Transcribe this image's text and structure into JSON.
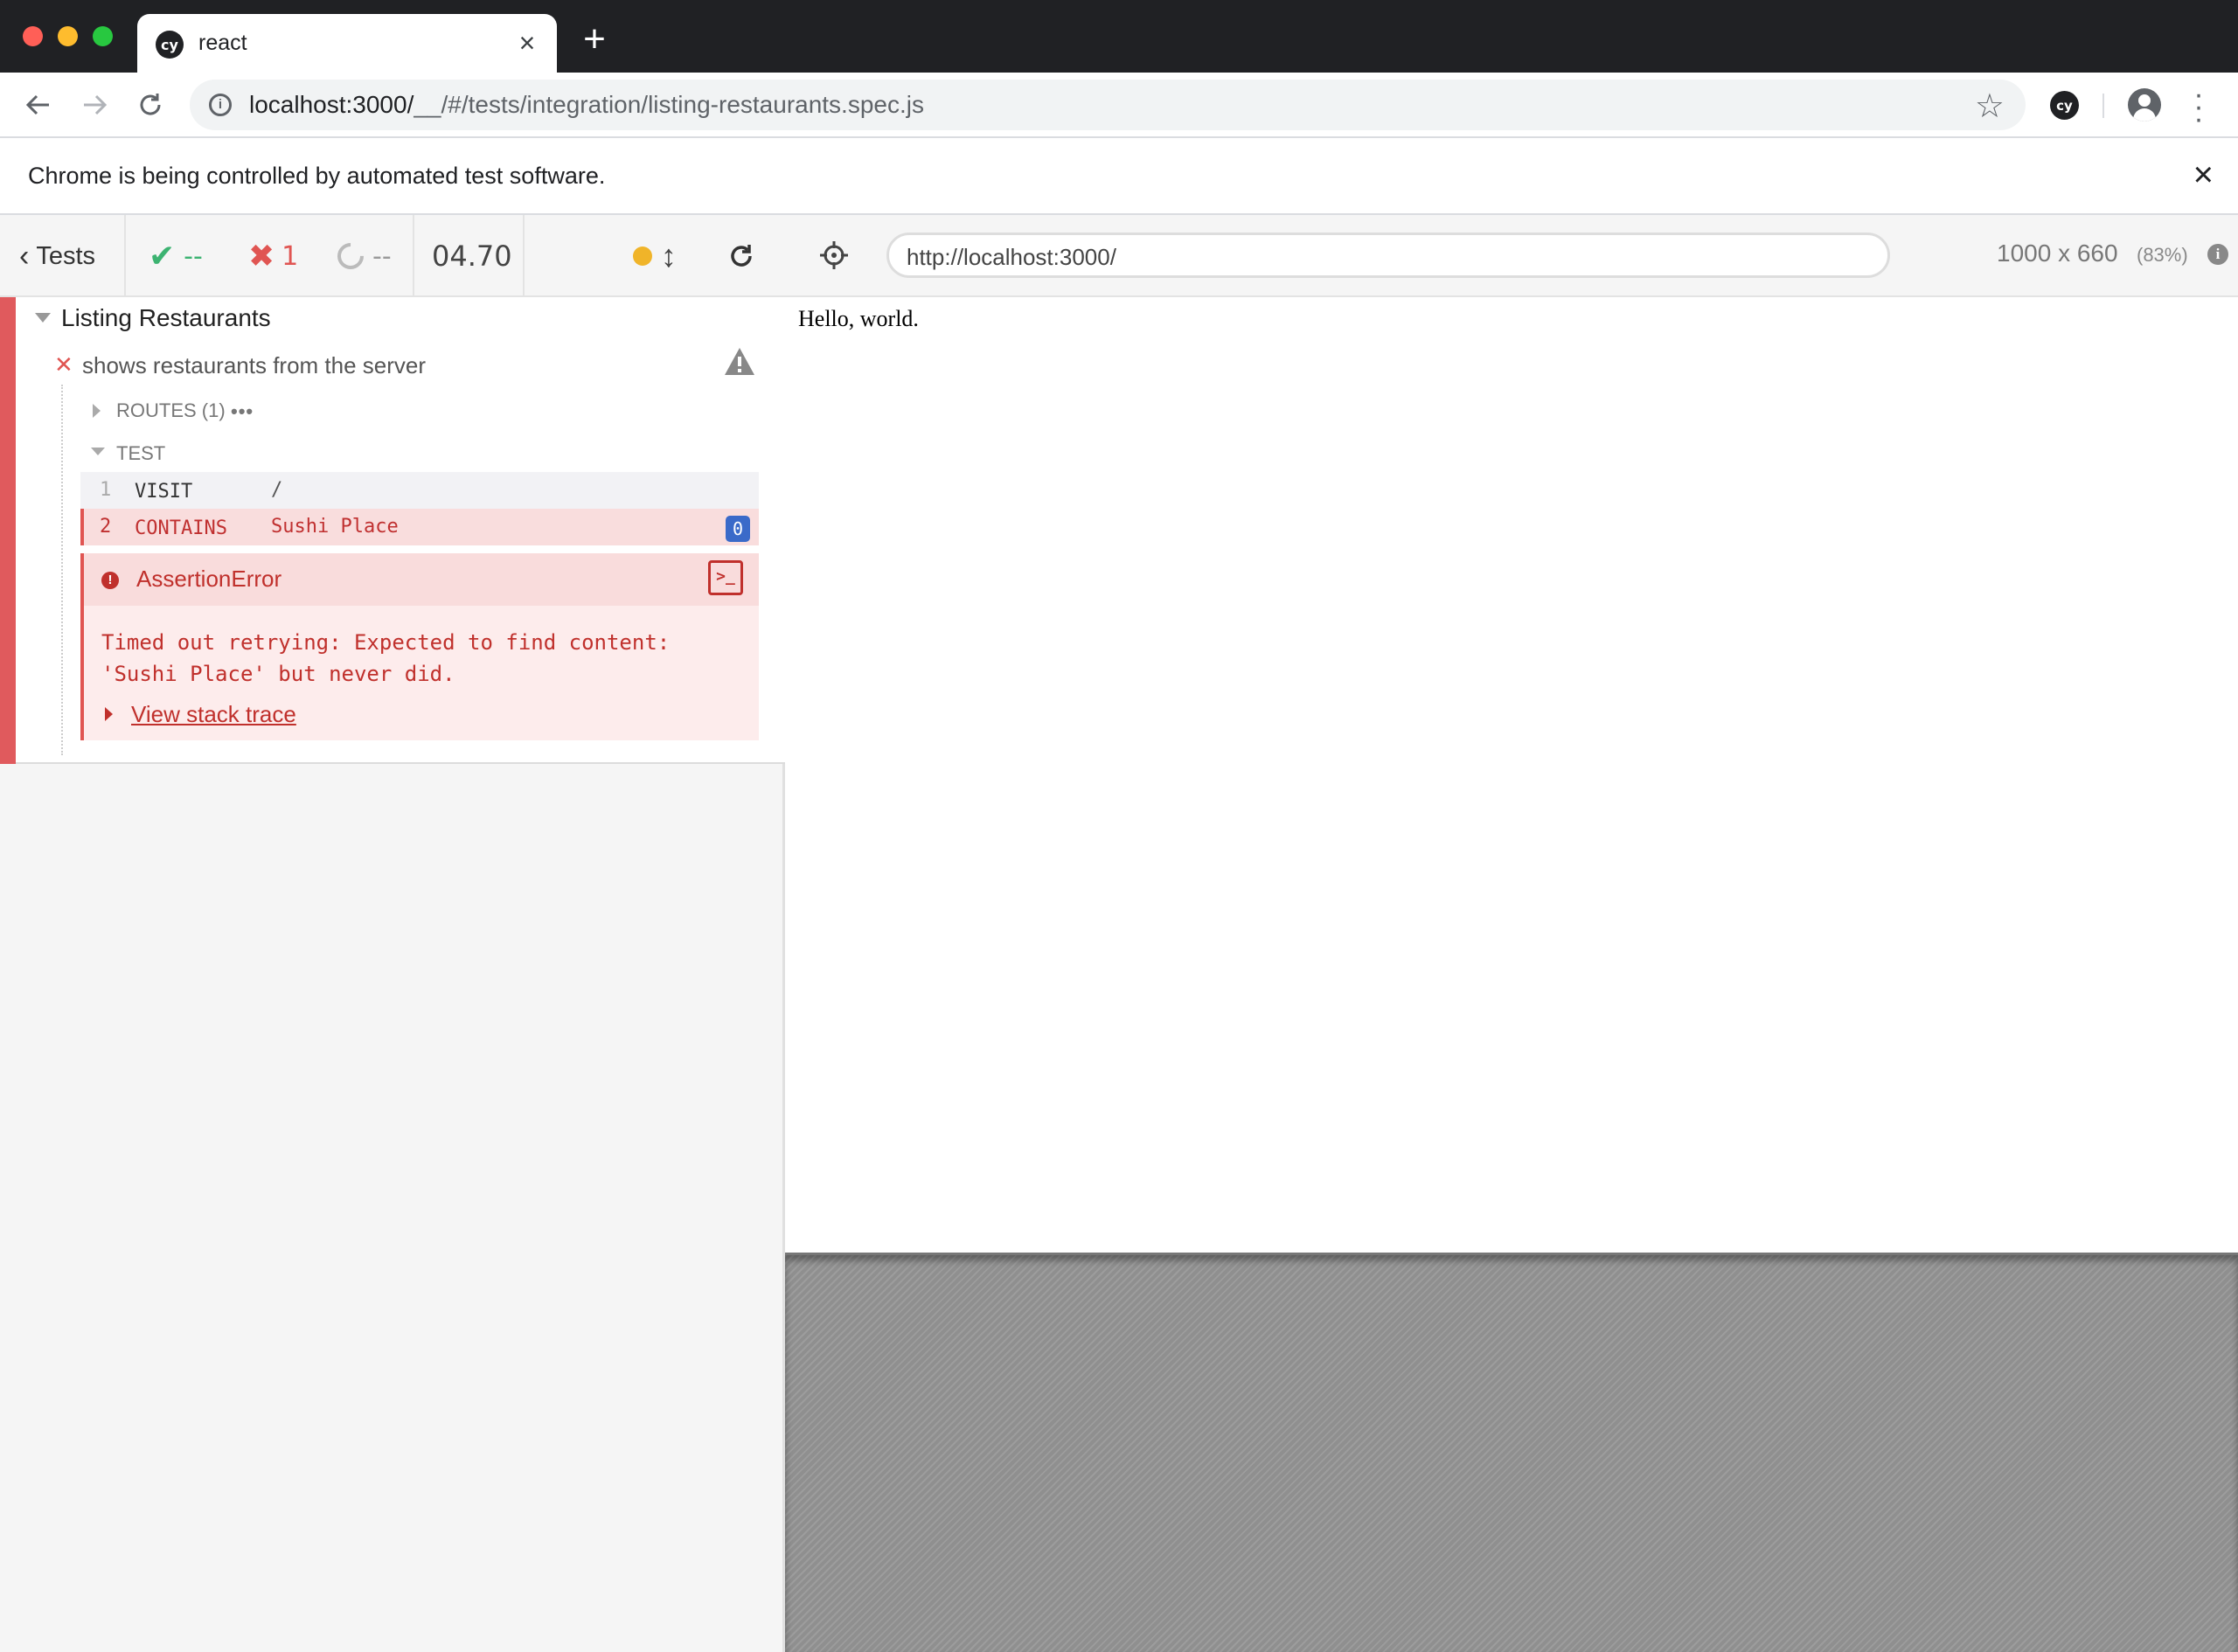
{
  "browser": {
    "tab_title": "react",
    "tab_favicon": "cy",
    "url_host": "localhost:3000/",
    "url_path": "__/#/tests/integration/listing-restaurants.spec.js",
    "extension_label": "cy",
    "infobar_text": "Chrome is being controlled by automated test software."
  },
  "reporter": {
    "tests_label": "Tests",
    "passed": "--",
    "failed": "1",
    "pending": "--",
    "duration": "04.70",
    "suite_title": "Listing Restaurants",
    "test_title": "shows restaurants from the server",
    "routes_label": "ROUTES (1)",
    "routes_more": "•••",
    "test_hook_label": "TEST",
    "commands": [
      {
        "number": "1",
        "name": "VISIT",
        "message": "/"
      },
      {
        "number": "2",
        "name": "CONTAINS",
        "message": "Sushi Place",
        "badge": "0"
      }
    ],
    "error": {
      "name": "AssertionError",
      "message": "Timed out retrying: Expected to find content: 'Sushi Place' but never did.",
      "stack_link": "View stack trace",
      "console_label": ">_"
    }
  },
  "aut": {
    "url": "http://localhost:3000/",
    "viewport_size": "1000 x 660",
    "viewport_scale": "(83%)",
    "page_text": "Hello, world."
  },
  "colors": {
    "fail": "#e05552",
    "pass": "#3cb371",
    "running_dot": "#f0b429",
    "badge": "#3a6ac9",
    "chrome_dark": "#202124"
  }
}
